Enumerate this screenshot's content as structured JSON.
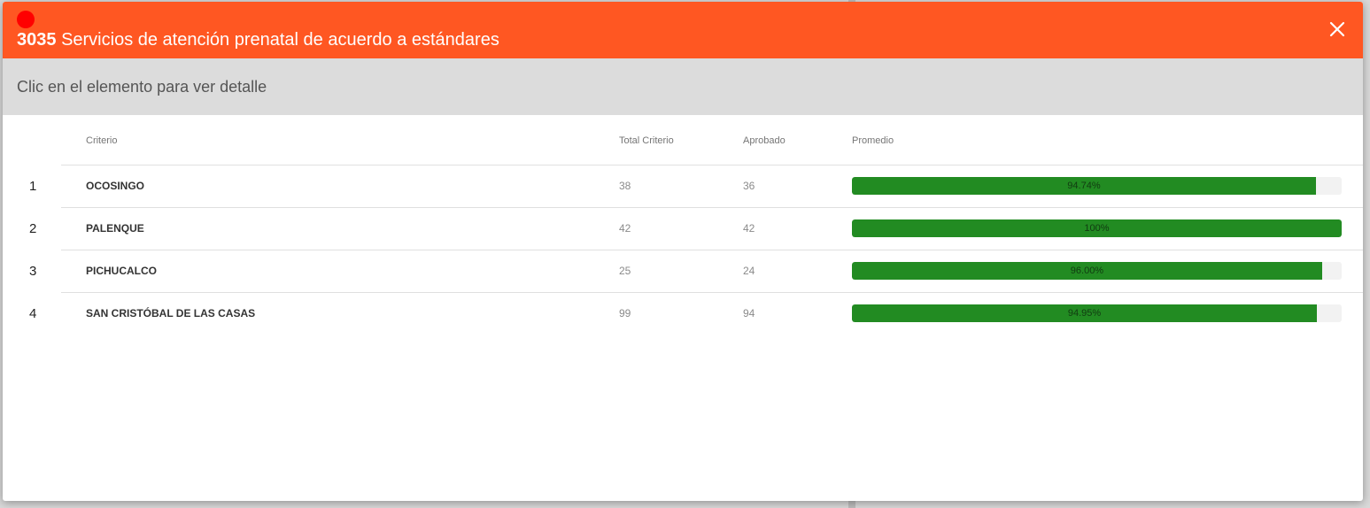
{
  "dialog": {
    "code": "3035",
    "title": "Servicios de atención prenatal de acuerdo a estándares",
    "status_color": "#ff0000",
    "header_color": "#ff5722",
    "close_icon": "close-icon"
  },
  "subheader": {
    "text": "Clic en el elemento para ver detalle"
  },
  "table": {
    "columns": {
      "criterio": "Criterio",
      "total": "Total Criterio",
      "aprobado": "Aprobado",
      "promedio": "Promedio"
    },
    "bar_color": "#228b22",
    "rows": [
      {
        "index": "1",
        "criterio": "OCOSINGO",
        "total": "38",
        "aprobado": "36",
        "promedio_label": "94.74%",
        "promedio_value": 94.74
      },
      {
        "index": "2",
        "criterio": "PALENQUE",
        "total": "42",
        "aprobado": "42",
        "promedio_label": "100%",
        "promedio_value": 100
      },
      {
        "index": "3",
        "criterio": "PICHUCALCO",
        "total": "25",
        "aprobado": "24",
        "promedio_label": "96.00%",
        "promedio_value": 96.0
      },
      {
        "index": "4",
        "criterio": "SAN CRISTÓBAL DE LAS CASAS",
        "total": "99",
        "aprobado": "94",
        "promedio_label": "94.95%",
        "promedio_value": 94.95
      }
    ]
  }
}
